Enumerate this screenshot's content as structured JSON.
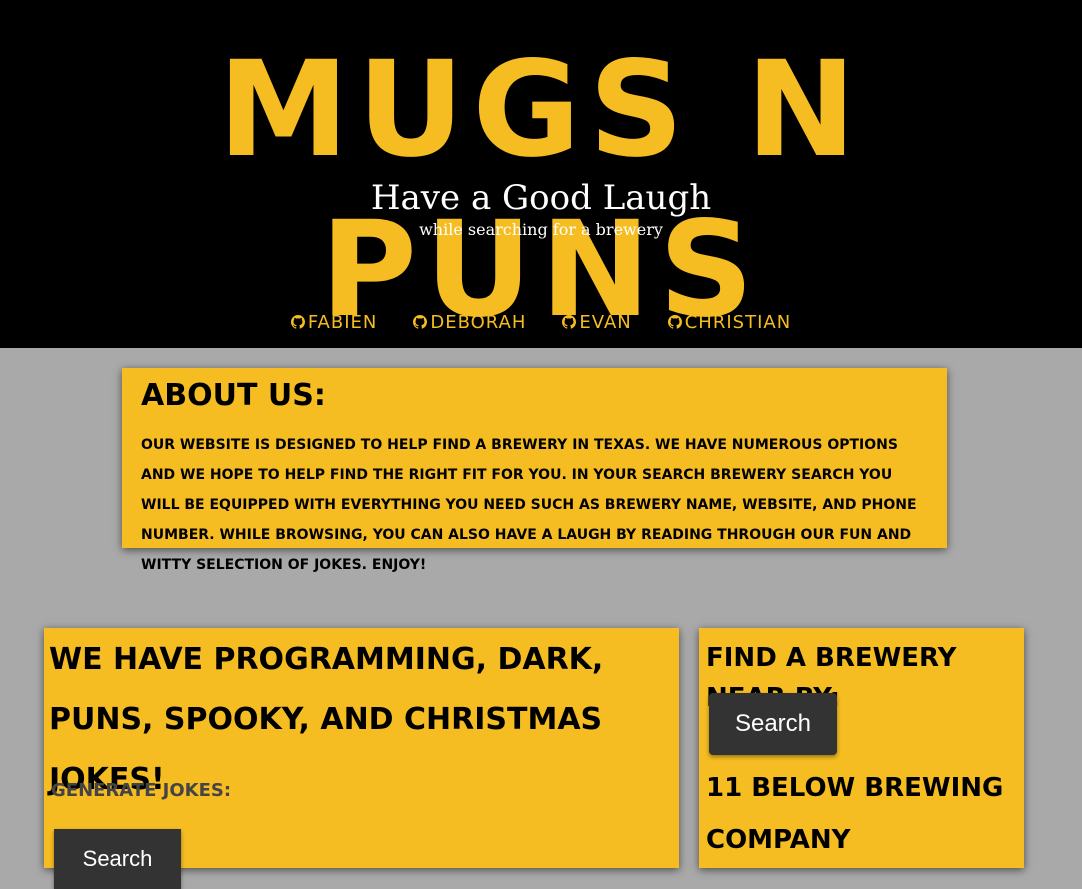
{
  "header": {
    "logo": "Mugs N Puns",
    "tagline": "Have a Good Laugh",
    "subtagline": "while searching for a brewery"
  },
  "nav": {
    "items": [
      {
        "label": "Fabien",
        "icon": "github-icon"
      },
      {
        "label": "Deborah",
        "icon": "github-icon"
      },
      {
        "label": "Evan",
        "icon": "github-icon"
      },
      {
        "label": "Christian",
        "icon": "github-icon"
      }
    ]
  },
  "about": {
    "title": "About Us:",
    "body": "Our website is designed to help find a brewery in Texas. We have numerous options and we hope to help find the right fit for you. In your search brewery search you will be equipped with everything you need such as brewery name, website, and phone number. While browsing, you can also have a laugh by reading through our fun and witty selection of jokes. Enjoy!"
  },
  "jokes": {
    "title": "We have programming, dark, puns, spooky, and christmas jokes!",
    "generate_label": "Generate Jokes:",
    "generate_button": "Search"
  },
  "brewery": {
    "title": "Find a brewery near by:",
    "search_button": "Search",
    "first_result": "11 Below Brewing Company"
  },
  "colors": {
    "accent": "#f6bd22",
    "header_bg": "#000000",
    "page_bg": "#a9a9a9",
    "button_bg": "#333333"
  }
}
